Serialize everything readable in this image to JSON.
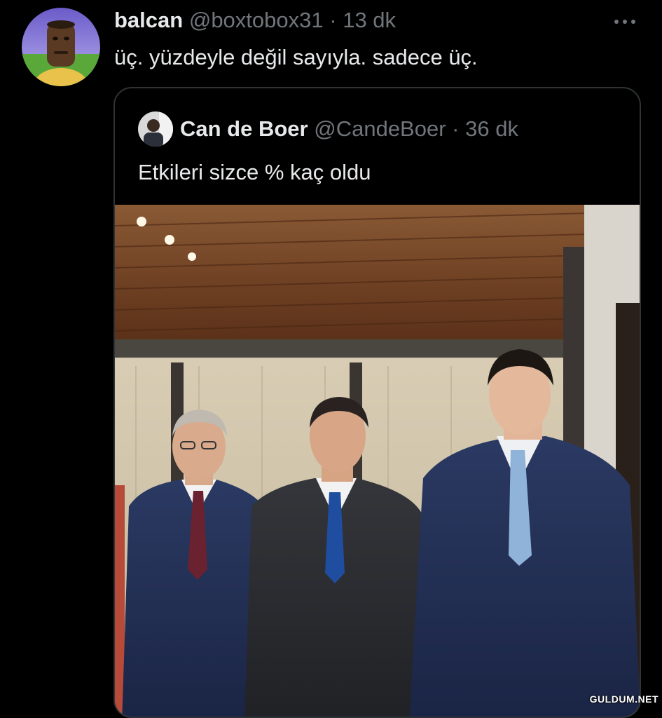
{
  "tweet": {
    "display_name": "balcan",
    "handle": "@boxtobox31",
    "separator": "·",
    "time": "13 dk",
    "more_icon": "more-horizontal-icon",
    "text": "üç. yüzdeyle değil sayıyla. sadece üç."
  },
  "quoted_tweet": {
    "display_name": "Can de Boer",
    "handle": "@CandeBoer",
    "separator": "·",
    "time": "36 dk",
    "text": "Etkileri sizce % kaç oldu"
  },
  "watermark": "GULDUM.NET",
  "colors": {
    "background": "#000000",
    "text_primary": "#e7e9ea",
    "text_secondary": "#71767b",
    "border": "#2f3336"
  }
}
